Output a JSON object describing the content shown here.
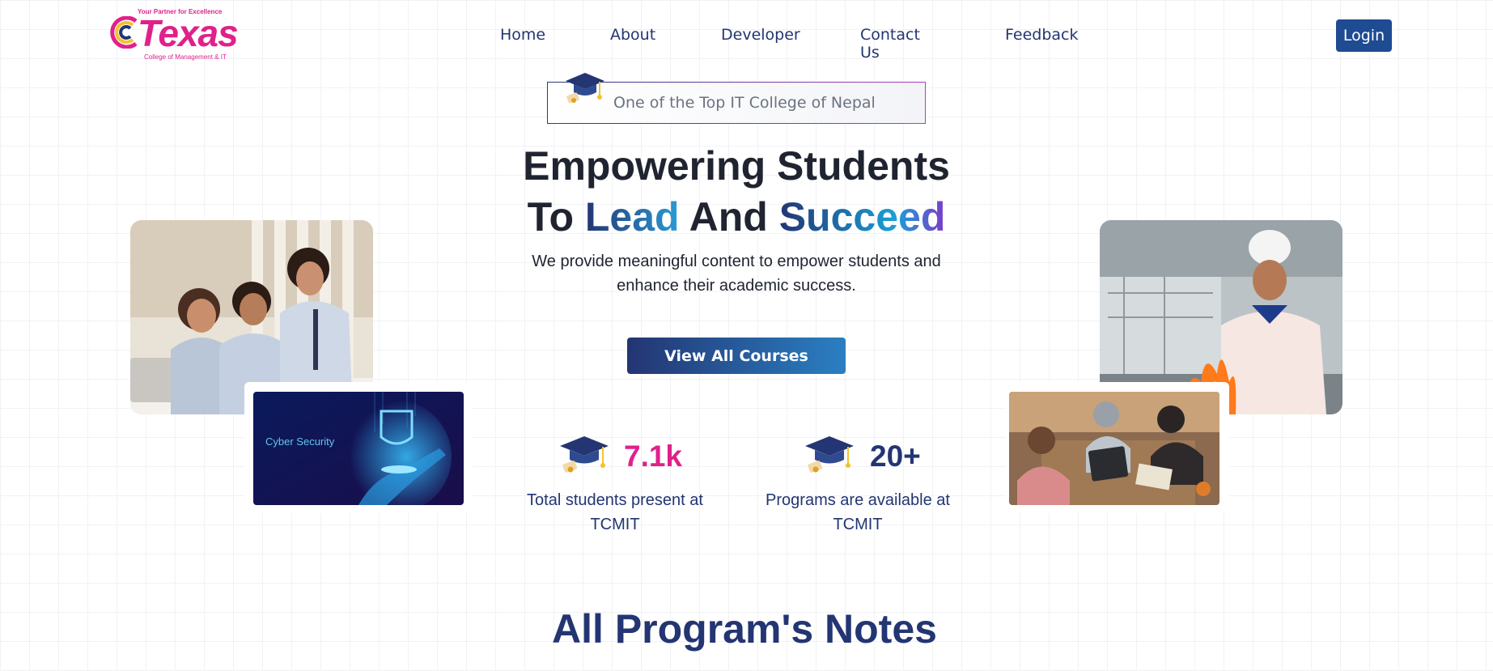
{
  "logo": {
    "tagline": "Your Partner for Excellence",
    "word": "Texas",
    "subtitle": "College of Management & IT"
  },
  "nav": {
    "items": [
      {
        "label": "Home"
      },
      {
        "label": "About"
      },
      {
        "label": "Developer"
      },
      {
        "label": "Contact Us"
      },
      {
        "label": "Feedback"
      }
    ],
    "login_label": "Login"
  },
  "hero": {
    "badge_text": "One of the Top IT College of Nepal",
    "title_line1": "Empowering Students",
    "title_line2_a": "To ",
    "title_line2_b": "Lead",
    "title_line2_c": " And ",
    "title_line2_d": "Succeed",
    "description": "We provide meaningful content to empower students and enhance their academic success.",
    "cta_label": "View All Courses"
  },
  "stats": [
    {
      "value": "7.1k",
      "label": "Total students present at TCMIT",
      "color": "#e0218a"
    },
    {
      "value": "20+",
      "label": "Programs are available at TCMIT",
      "color": "#233572"
    }
  ],
  "images": {
    "cyber_caption": "Cyber Security"
  },
  "section": {
    "title": "All Program's Notes"
  },
  "colors": {
    "brand_navy": "#233572",
    "brand_pink": "#e0218a",
    "login_bg": "#1e4b92"
  }
}
